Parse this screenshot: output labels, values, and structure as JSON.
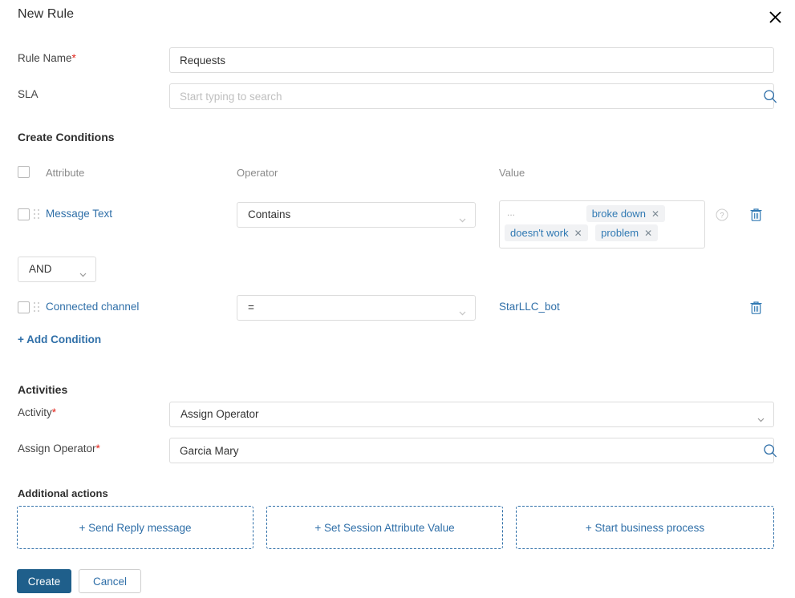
{
  "dialog": {
    "title": "New Rule",
    "close_icon": "close-icon"
  },
  "fields": {
    "rule_name": {
      "label": "Rule Name",
      "required_mark": "*",
      "value": "Requests"
    },
    "sla": {
      "label": "SLA",
      "value": "",
      "placeholder": "Start typing to search",
      "icon": "search-icon"
    }
  },
  "conditions": {
    "section_title": "Create Conditions",
    "columns": {
      "attribute": "Attribute",
      "operator": "Operator",
      "value": "Value"
    },
    "logic_operator": {
      "value": "AND",
      "icon": "chevron-down-icon"
    },
    "rows": [
      {
        "attribute": "Message Text",
        "operator": "Contains",
        "value_type": "tags",
        "overflow_mark": "...",
        "tags": [
          "broke down",
          "doesn't work",
          "problem"
        ],
        "tag_remove_icon": "close-icon",
        "help_icon": "help-circle-icon",
        "delete_icon": "trash-icon",
        "drag_icon": "drag-handle-icon"
      },
      {
        "attribute": "Connected channel",
        "operator": "=",
        "value_type": "text",
        "value": "StarLLC_bot",
        "delete_icon": "trash-icon",
        "drag_icon": "drag-handle-icon"
      }
    ],
    "add_condition_label": "+ Add Condition"
  },
  "activities": {
    "section_title": "Activities",
    "activity": {
      "label": "Activity",
      "required_mark": "*",
      "value": "Assign Operator",
      "icon": "chevron-down-icon"
    },
    "assign_operator": {
      "label": "Assign Operator",
      "required_mark": "*",
      "value": "Garcia Mary",
      "icon": "search-icon"
    }
  },
  "additional_actions": {
    "title": "Additional actions",
    "buttons": [
      {
        "label": "+ Send Reply message"
      },
      {
        "label": "+ Set Session Attribute Value"
      },
      {
        "label": "+ Start business process"
      }
    ]
  },
  "footer": {
    "create_label": "Create",
    "cancel_label": "Cancel"
  },
  "colors": {
    "link": "#2f6fa8",
    "primary_button": "#1f5f8b",
    "required": "#e2231a",
    "tag_background": "#f1f2f4"
  }
}
